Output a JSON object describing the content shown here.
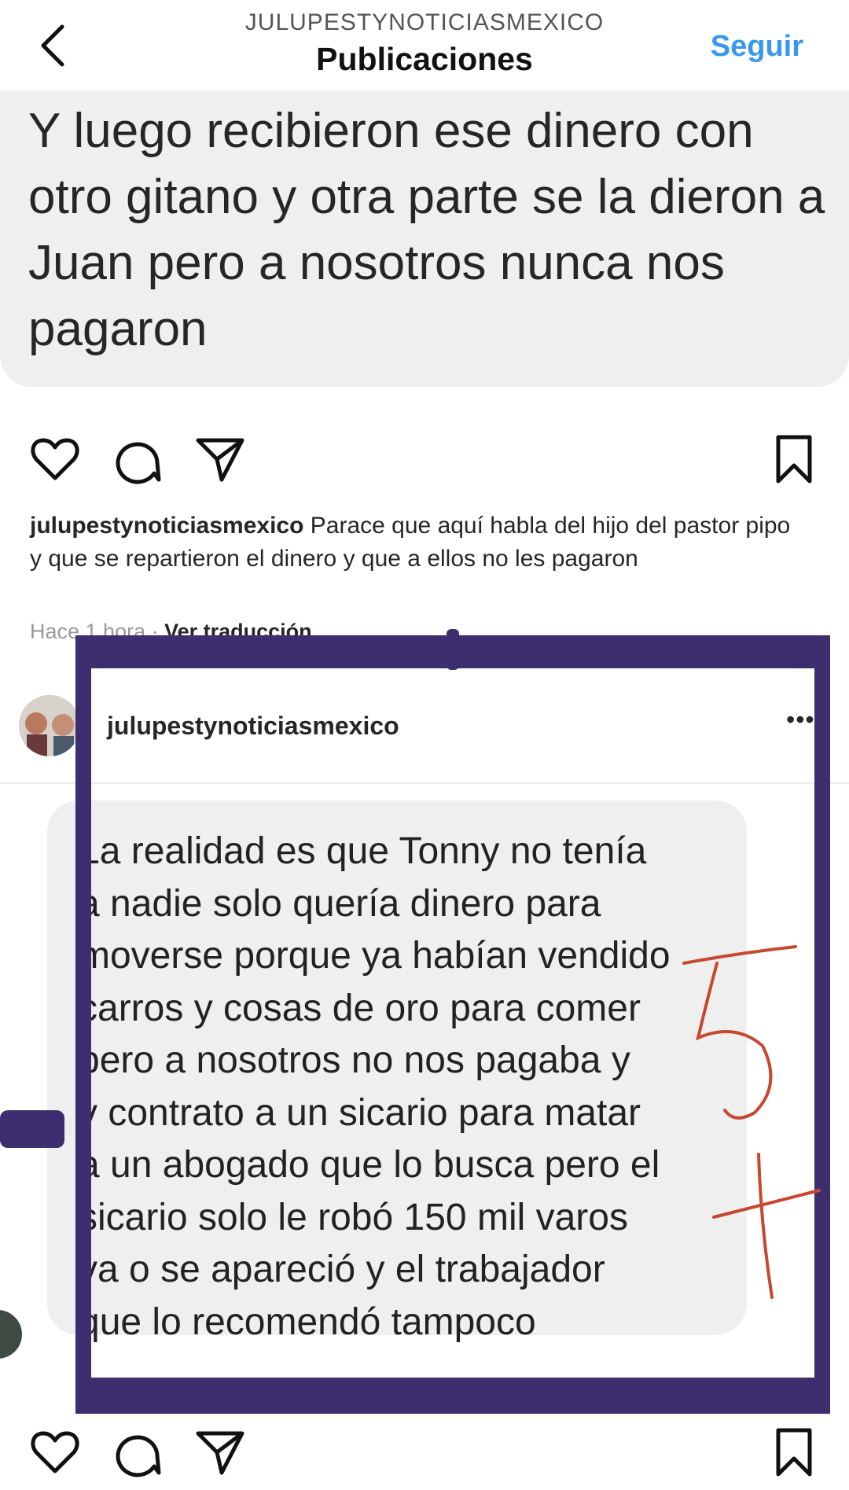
{
  "header": {
    "account_handle": "JULUPESTYNOTICIASMEXICO",
    "title": "Publicaciones",
    "follow_label": "Seguir"
  },
  "post1": {
    "image_text": "Y luego recibieron ese dinero con otro gitano y otra parte se la dieron a Juan pero a nosotros nunca nos pagaron",
    "caption_user": "julupestynoticiasmexico",
    "caption_text": " Parace que aquí habla del hijo del pastor pipo y que se repartieron el dinero y que a ellos no les pagaron",
    "time": "Hace 1 hora",
    "dot": " · ",
    "translate_label": "Ver traducción"
  },
  "post2": {
    "username": "julupestynoticiasmexico",
    "more_label": "•••",
    "lines": [
      "La realidad es que Tonny no tenía",
      "a nadie solo quería dinero para",
      "moverse porque ya habían vendido",
      "carros y cosas de oro para comer",
      "pero a nosotros no nos pagaba y",
      "y contrato a un sicario para matar",
      "a un abogado que lo busca pero el",
      "sicario solo le robó 150 mil varos",
      "ya  o se apareció y el trabajador",
      "que lo recomendó tampoco"
    ]
  },
  "icons": {
    "back": "chevron-left-icon",
    "like": "heart-icon",
    "comment": "comment-icon",
    "share": "send-icon",
    "save": "bookmark-icon"
  },
  "colors": {
    "link_blue": "#3897f0",
    "bubble_gray": "#efeff0",
    "highlight_purple": "#3d2e70",
    "handwriting_red": "#c8472f"
  }
}
